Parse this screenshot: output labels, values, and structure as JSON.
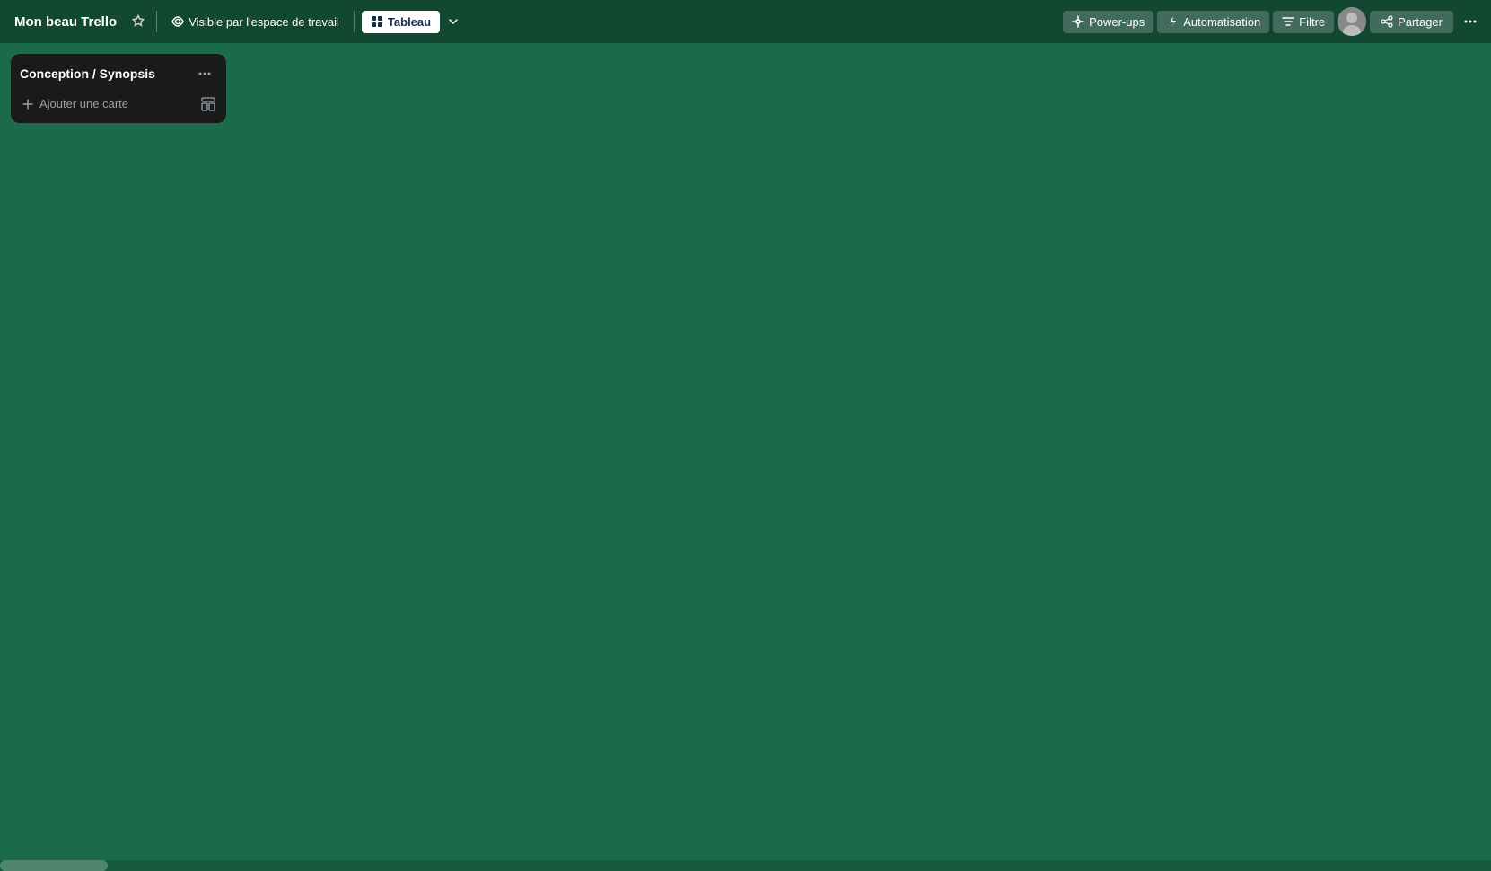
{
  "navbar": {
    "board_title": "Mon beau Trello",
    "star_icon": "★",
    "visibility_icon": "👁",
    "visibility_label": "Visible par l'espace de travail",
    "tableau_icon": "⊞",
    "tableau_label": "Tableau",
    "chevron_icon": "∨",
    "powerups_label": "Power-ups",
    "automation_label": "Automatisation",
    "filter_label": "Filtre",
    "share_label": "Partager",
    "more_icon": "•••"
  },
  "list": {
    "title": "Conception / Synopsis",
    "menu_icon": "•••",
    "add_card_label": "Ajouter une carte",
    "add_icon": "+",
    "template_icon": "⊟"
  },
  "colors": {
    "background": "#1b6b4a",
    "navbar_bg": "rgba(0,0,0,0.32)",
    "list_bg": "#1a1a1a"
  }
}
